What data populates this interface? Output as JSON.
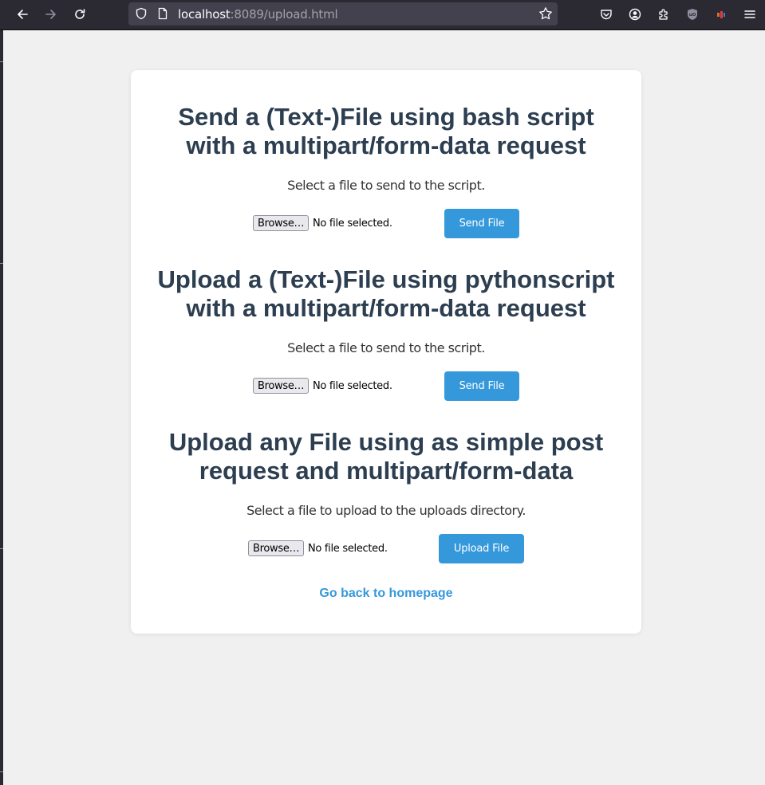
{
  "browser": {
    "url_host": "localhost",
    "url_path": ":8089/upload.html",
    "icons": {
      "back": "arrow-left-icon",
      "forward": "arrow-right-icon",
      "reload": "reload-icon",
      "shield": "shield-icon",
      "page": "page-icon",
      "bookmark": "star-icon",
      "pocket": "pocket-icon",
      "account": "account-icon",
      "extensions": "puzzle-icon",
      "ublock": "ublock-icon",
      "menu": "hamburger-icon"
    },
    "ublock_label": "uO"
  },
  "sections": [
    {
      "title_line1": "Send a (Text-)File using bash script",
      "title_line2": "with a multipart/form-data request",
      "description": "Select a file to send to the script.",
      "browse_label": "Browse…",
      "file_status": "No file selected.",
      "submit_label": "Send File"
    },
    {
      "title_line1": "Upload a (Text-)File using pythonscript",
      "title_line2": "with a multipart/form-data request",
      "description": "Select a file to send to the script.",
      "browse_label": "Browse…",
      "file_status": "No file selected.",
      "submit_label": "Send File"
    },
    {
      "title_line1": "Upload any File using as simple post",
      "title_line2": "request and multipart/form-data",
      "description": "Select a file to upload to the uploads directory.",
      "browse_label": "Browse…",
      "file_status": "No file selected.",
      "submit_label": "Upload File"
    }
  ],
  "home_link": "Go back to homepage",
  "colors": {
    "heading": "#2c3e50",
    "accent": "#3498db",
    "page_background": "#f0f0f0",
    "toolbar": "#2b2a33"
  }
}
